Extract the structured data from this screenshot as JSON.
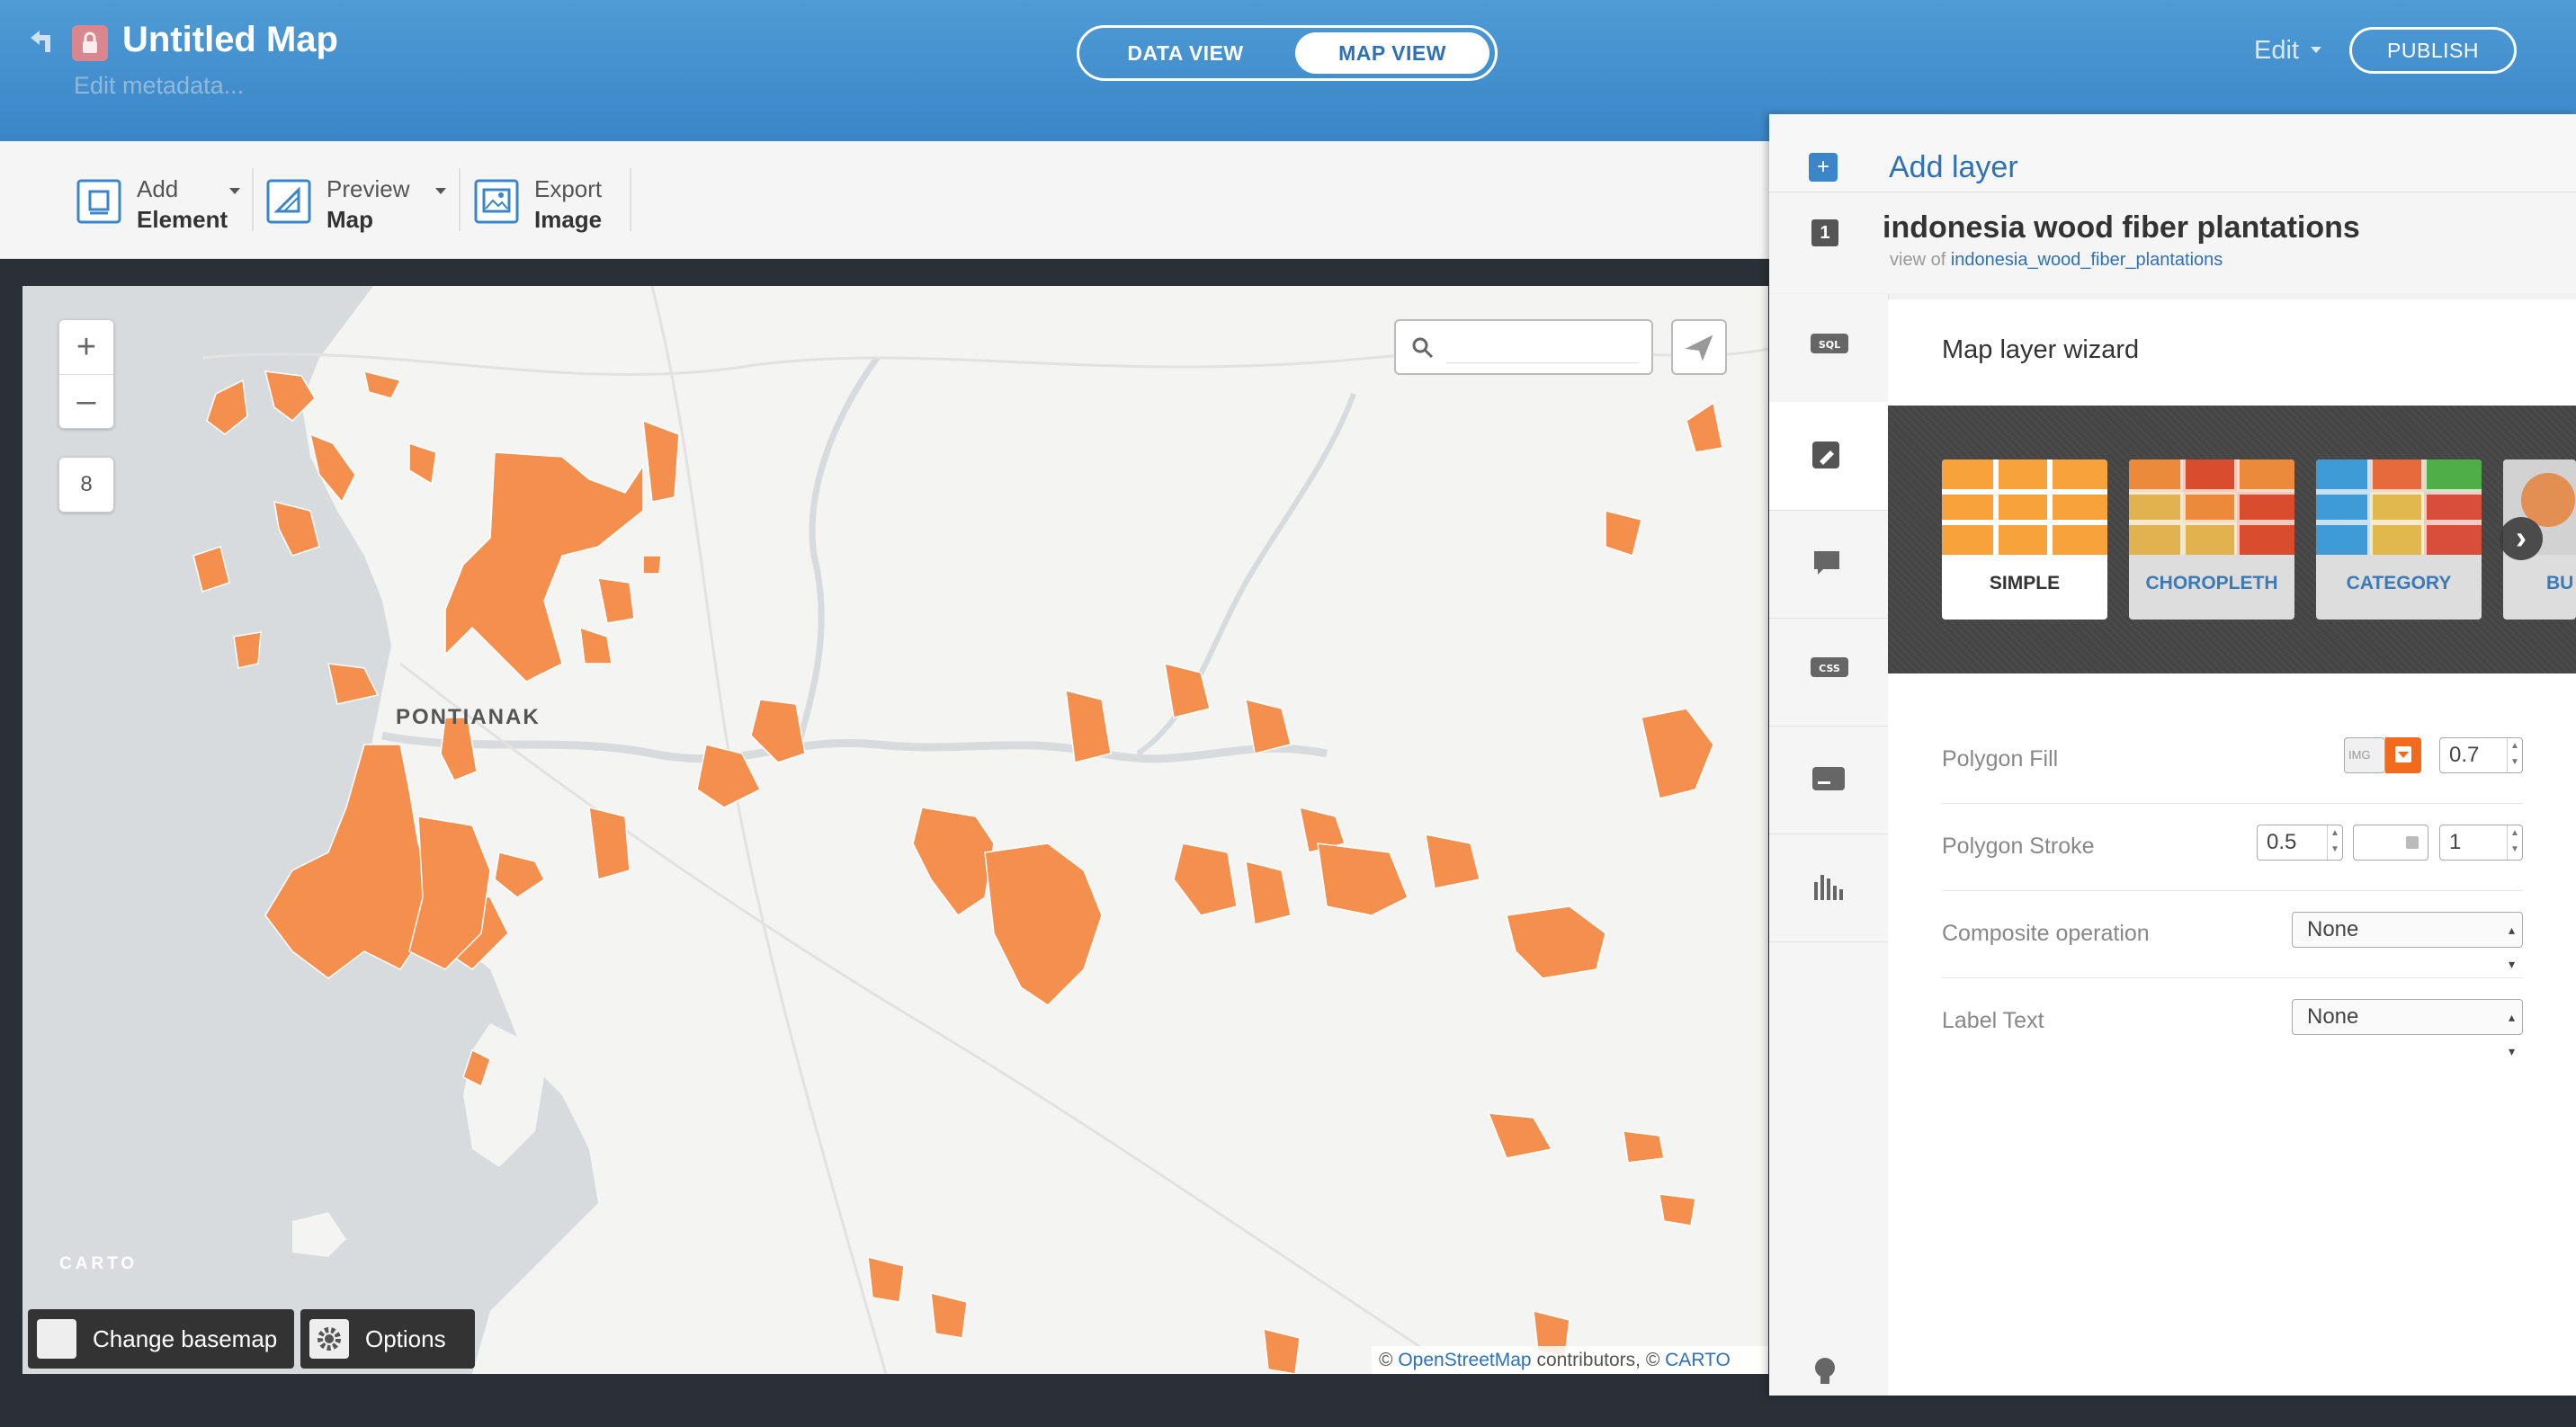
{
  "header": {
    "title": "Untitled Map",
    "subtitle": "Edit metadata...",
    "tabs": [
      {
        "label": "DATA VIEW"
      },
      {
        "label": "MAP VIEW"
      }
    ],
    "edit_label": "Edit",
    "publish_label": "PUBLISH"
  },
  "toolbar": {
    "items": [
      {
        "line1": "Add",
        "line2": "Element"
      },
      {
        "line1": "Preview",
        "line2": "Map"
      },
      {
        "line1": "Export",
        "line2": "Image"
      }
    ]
  },
  "map": {
    "zoom_in": "+",
    "zoom_out": "–",
    "zoom_level": "8",
    "city_label": "PONTIANAK",
    "carto_logo": "CARTO",
    "basemap_btn": "Change basemap",
    "options_btn": "Options",
    "attribution": {
      "prefix": "©",
      "osm": "OpenStreetMap",
      "mid": "contributors, ©",
      "carto": "CARTO"
    },
    "search_placeholder": "",
    "colors": {
      "land": "#f4f4f2",
      "water": "#d7dbdd",
      "plantation": "#f58f4d"
    }
  },
  "panel": {
    "add_layer": "Add layer",
    "layer": {
      "number": "1",
      "name": "indonesia wood fiber plantations",
      "view_of_prefix": "view of",
      "view_of_table": "indonesia_wood_fiber_plantations"
    },
    "side_tools": [
      "sql-icon",
      "wizard-brush-icon",
      "infowindow-icon",
      "css-icon",
      "legend-icon",
      "filters-icon"
    ],
    "wizard": {
      "title": "Map layer wizard",
      "types": [
        "SIMPLE",
        "CHOROPLETH",
        "CATEGORY",
        "BU"
      ],
      "selected_type": "SIMPLE",
      "properties": {
        "polygon_fill": {
          "label": "Polygon Fill",
          "img_badge": "IMG",
          "opacity": "0.7",
          "color": "#f26b1d"
        },
        "polygon_stroke": {
          "label": "Polygon Stroke",
          "width": "0.5",
          "opacity": "1"
        },
        "composite": {
          "label": "Composite operation",
          "value": "None"
        },
        "label_text": {
          "label": "Label Text",
          "value": "None"
        }
      }
    }
  }
}
